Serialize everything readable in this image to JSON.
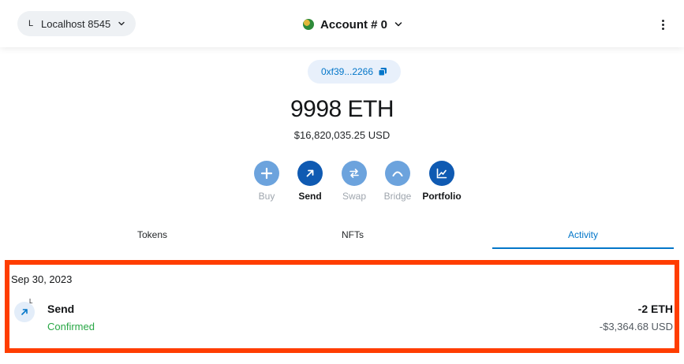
{
  "header": {
    "network_initial": "L",
    "network_name": "Localhost 8545",
    "account_name": "Account # 0"
  },
  "address": {
    "short": "0xf39...2266"
  },
  "balance": {
    "amount": "9998 ETH",
    "fiat": "$16,820,035.25 USD"
  },
  "actions": [
    {
      "label": "Buy",
      "icon": "plus-icon",
      "active": false
    },
    {
      "label": "Send",
      "icon": "arrow-up-right-icon",
      "active": true
    },
    {
      "label": "Swap",
      "icon": "swap-icon",
      "active": false
    },
    {
      "label": "Bridge",
      "icon": "bridge-icon",
      "active": false
    },
    {
      "label": "Portfolio",
      "icon": "chart-icon",
      "active": true
    }
  ],
  "tabs": [
    {
      "label": "Tokens",
      "active": false
    },
    {
      "label": "NFTs",
      "active": false
    },
    {
      "label": "Activity",
      "active": true
    }
  ],
  "activity": {
    "date": "Sep 30, 2023",
    "items": [
      {
        "badge": "L",
        "title": "Send",
        "status": "Confirmed",
        "amount": "-2 ETH",
        "fiat": "-$3,364.68 USD"
      }
    ]
  },
  "colors": {
    "accent": "#0376c9",
    "success": "#28a745",
    "highlight": "#ff3d00",
    "button_light": "#6ca3dd",
    "button_dark": "#0f5ab2"
  }
}
